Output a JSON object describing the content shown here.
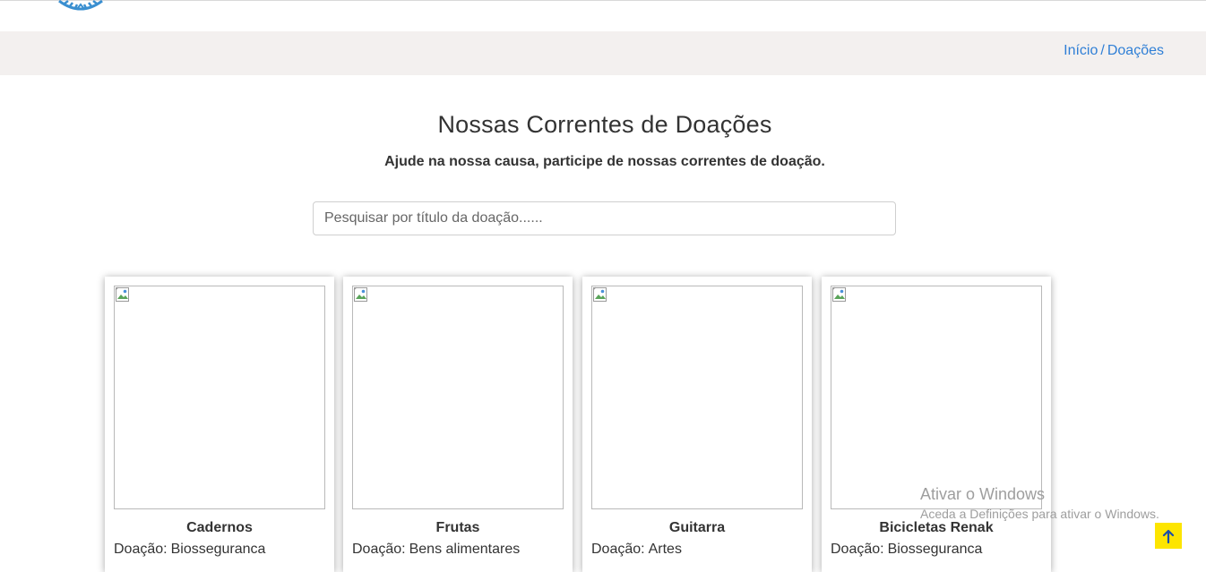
{
  "breadcrumb": {
    "home": "Início",
    "separator": "/",
    "current": "Doações"
  },
  "heading": {
    "title": "Nossas Correntes de Doações",
    "subtitle": "Ajude na nossa causa, participe de nossas correntes de doação."
  },
  "search": {
    "placeholder": "Pesquisar por título da doação......",
    "value": ""
  },
  "cards": [
    {
      "title": "Cadernos",
      "category_label": "Doação:",
      "category": "Biosseguranca"
    },
    {
      "title": "Frutas",
      "category_label": "Doação:",
      "category": "Bens alimentares"
    },
    {
      "title": "Guitarra",
      "category_label": "Doação:",
      "category": "Artes"
    },
    {
      "title": "Bicicletas Renak",
      "category_label": "Doação:",
      "category": "Biosseguranca"
    }
  ],
  "watermark": {
    "title": "Ativar o Windows",
    "subtitle": "Aceda a Definições para ativar o Windows."
  },
  "icons": {
    "logo": "logo-icon",
    "broken_image": "broken-image-icon",
    "back_to_top": "arrow-up-icon"
  },
  "colors": {
    "link": "#2f7fd6",
    "breadcrumb_bg": "#f3f0ef",
    "back_to_top_bg": "#fde500",
    "logo": "#3a8fd0"
  }
}
